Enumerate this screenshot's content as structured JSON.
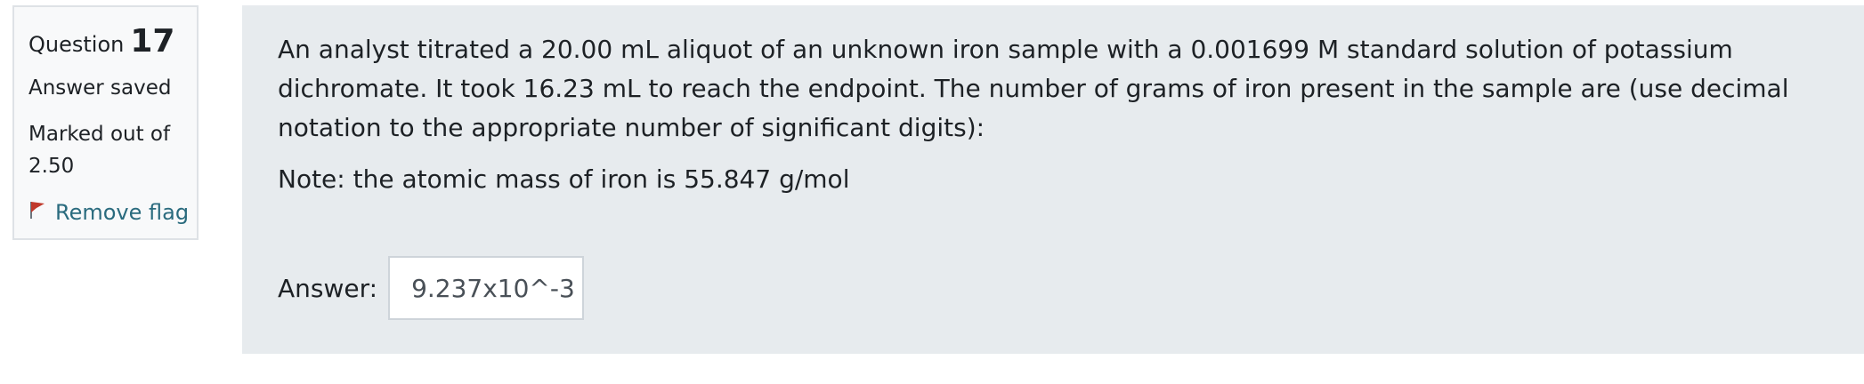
{
  "info": {
    "question_word": "Question",
    "question_number": "17",
    "state": "Answer saved",
    "grade": "Marked out of 2.50",
    "flag_label": "Remove flag",
    "flag_color": "#c0392b",
    "flag_icon": "flag-icon"
  },
  "question": {
    "text": "An analyst titrated a 20.00 mL aliquot of an unknown iron sample with a 0.001699 M standard solution of potassium dichromate.   It took 16.23 mL to reach the endpoint.   The number of grams of iron present in the sample are (use decimal notation to the appropriate number of significant digits):",
    "note": "Note:  the atomic mass of iron  is 55.847 g/mol"
  },
  "answer": {
    "label": "Answer:",
    "value": "9.237x10^-3"
  },
  "colors": {
    "content_bg": "#e7ebee",
    "info_bg": "#f8f9fa",
    "link": "#2a6b7e"
  }
}
